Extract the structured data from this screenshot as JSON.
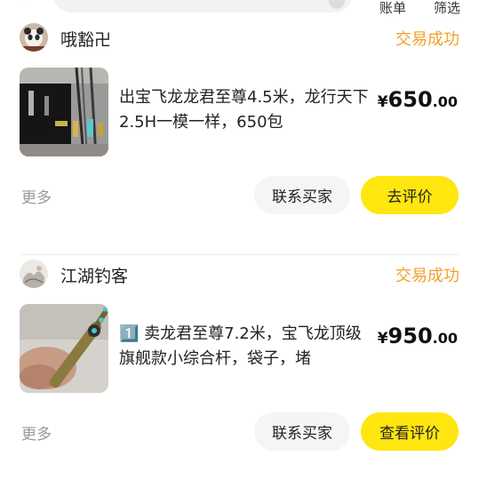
{
  "header": {
    "bill_label": "账单",
    "filter_label": "筛选"
  },
  "orders": [
    {
      "seller": "哦豁卍",
      "status": "交易成功",
      "title": "出宝飞龙龙君至尊4.5米，龙行天下2.5H一模一样，650包",
      "price_currency": "¥",
      "price_int": "650",
      "price_dec": ".00",
      "more": "更多",
      "contact_label": "联系买家",
      "action_label": "去评价"
    },
    {
      "seller": "江湖钓客",
      "status": "交易成功",
      "title": "1️⃣ 卖龙君至尊7.2米，宝飞龙顶级旗舰款小综合杆，袋子，堵",
      "price_currency": "¥",
      "price_int": "950",
      "price_dec": ".00",
      "more": "更多",
      "contact_label": "联系买家",
      "action_label": "查看评价"
    }
  ],
  "colors": {
    "status": "#f2a02b",
    "primary_button": "#ffe60f",
    "secondary_button": "#f5f5f5"
  }
}
